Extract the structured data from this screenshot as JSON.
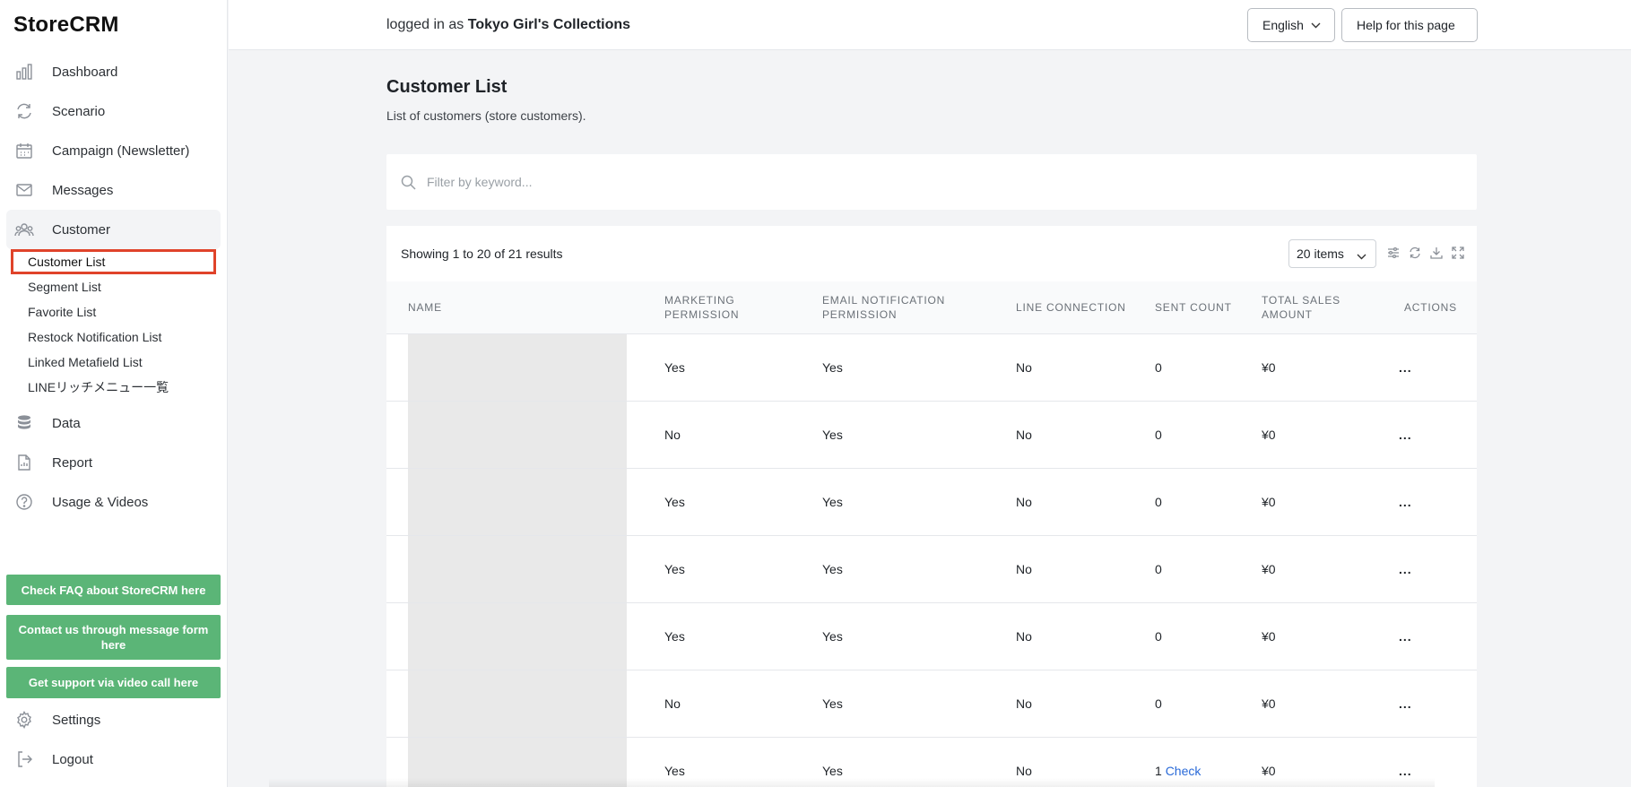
{
  "app": {
    "logo": "StoreCRM"
  },
  "sidebar": {
    "items": [
      {
        "label": "Dashboard",
        "icon": "bar-chart-icon"
      },
      {
        "label": "Scenario",
        "icon": "refresh-icon"
      },
      {
        "label": "Campaign (Newsletter)",
        "icon": "calendar-icon"
      },
      {
        "label": "Messages",
        "icon": "mail-icon"
      },
      {
        "label": "Customer",
        "icon": "users-icon"
      }
    ],
    "customer_sub": [
      {
        "label": "Customer List"
      },
      {
        "label": "Segment List"
      },
      {
        "label": "Favorite List"
      },
      {
        "label": "Restock Notification List"
      },
      {
        "label": "Linked Metafield List"
      },
      {
        "label": "LINEリッチメニュー一覧"
      }
    ],
    "items2": [
      {
        "label": "Data",
        "icon": "database-icon"
      },
      {
        "label": "Report",
        "icon": "document-icon"
      },
      {
        "label": "Usage & Videos",
        "icon": "help-circle-icon"
      }
    ],
    "buttons": {
      "faq": "Check FAQ about StoreCRM here",
      "contact": "Contact us through message form here",
      "video": "Get support via video call here"
    },
    "bottom": [
      {
        "label": "Settings",
        "icon": "gear-icon"
      },
      {
        "label": "Logout",
        "icon": "logout-icon"
      }
    ]
  },
  "header": {
    "logged_prefix": "logged in as",
    "store_name": "Tokyo Girl's Collections",
    "language": "English",
    "help": "Help for this page"
  },
  "page": {
    "title": "Customer List",
    "subtitle": "List of customers (store customers).",
    "search_placeholder": "Filter by keyword...",
    "showing": "Showing 1 to 20 of 21 results",
    "per_page": "20 items"
  },
  "table": {
    "headers": {
      "name": "NAME",
      "marketing": "MARKETING PERMISSION",
      "email": "EMAIL NOTIFICATION PERMISSION",
      "line": "LINE CONNECTION",
      "sent": "SENT COUNT",
      "sales": "TOTAL SALES AMOUNT",
      "actions": "ACTIONS"
    },
    "rows": [
      {
        "marketing": "Yes",
        "email": "Yes",
        "line": "No",
        "sent": "0",
        "sent_link": "",
        "sales": "¥0",
        "actions": "..."
      },
      {
        "marketing": "No",
        "email": "Yes",
        "line": "No",
        "sent": "0",
        "sent_link": "",
        "sales": "¥0",
        "actions": "..."
      },
      {
        "marketing": "Yes",
        "email": "Yes",
        "line": "No",
        "sent": "0",
        "sent_link": "",
        "sales": "¥0",
        "actions": "..."
      },
      {
        "marketing": "Yes",
        "email": "Yes",
        "line": "No",
        "sent": "0",
        "sent_link": "",
        "sales": "¥0",
        "actions": "..."
      },
      {
        "marketing": "Yes",
        "email": "Yes",
        "line": "No",
        "sent": "0",
        "sent_link": "",
        "sales": "¥0",
        "actions": "..."
      },
      {
        "marketing": "No",
        "email": "Yes",
        "line": "No",
        "sent": "0",
        "sent_link": "",
        "sales": "¥0",
        "actions": "..."
      },
      {
        "marketing": "Yes",
        "email": "Yes",
        "line": "No",
        "sent": "1",
        "sent_link": "Check",
        "sales": "¥0",
        "actions": "..."
      }
    ]
  }
}
